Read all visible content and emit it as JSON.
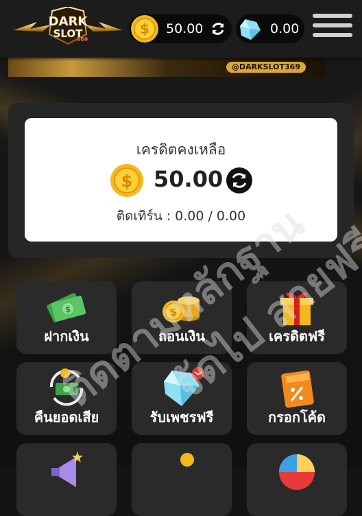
{
  "header": {
    "logo_text": "DARK SLOT 369",
    "coin_balance": "50.00",
    "gem_balance": "0.00"
  },
  "banner": {
    "tag": "@DARKSLOT369"
  },
  "credit": {
    "title": "เครดิตคงเหลือ",
    "amount": "50.00",
    "withdraw_line": "ติดเทิร์น : 0.00 / 0.00"
  },
  "tiles": [
    {
      "label": "ฝากเงิน",
      "icon": "money-stack-icon"
    },
    {
      "label": "ถอนเงิน",
      "icon": "coin-stack-icon"
    },
    {
      "label": "เครดิตฟรี",
      "icon": "gift-box-icon"
    },
    {
      "label": "คืนยอดเสีย",
      "icon": "cashback-icon"
    },
    {
      "label": "รับเพชรฟรี",
      "icon": "diamond-icon"
    },
    {
      "label": "กรอกโค้ด",
      "icon": "coupon-icon"
    }
  ],
  "watermark": {
    "line1": "ติดตามหลักฐาน",
    "line2": "จัดไป สายฟรี"
  },
  "colors": {
    "gold": "#f5b81c",
    "gem": "#7fd6f0",
    "panel": "#262626",
    "tile": "#2a2a2a"
  }
}
